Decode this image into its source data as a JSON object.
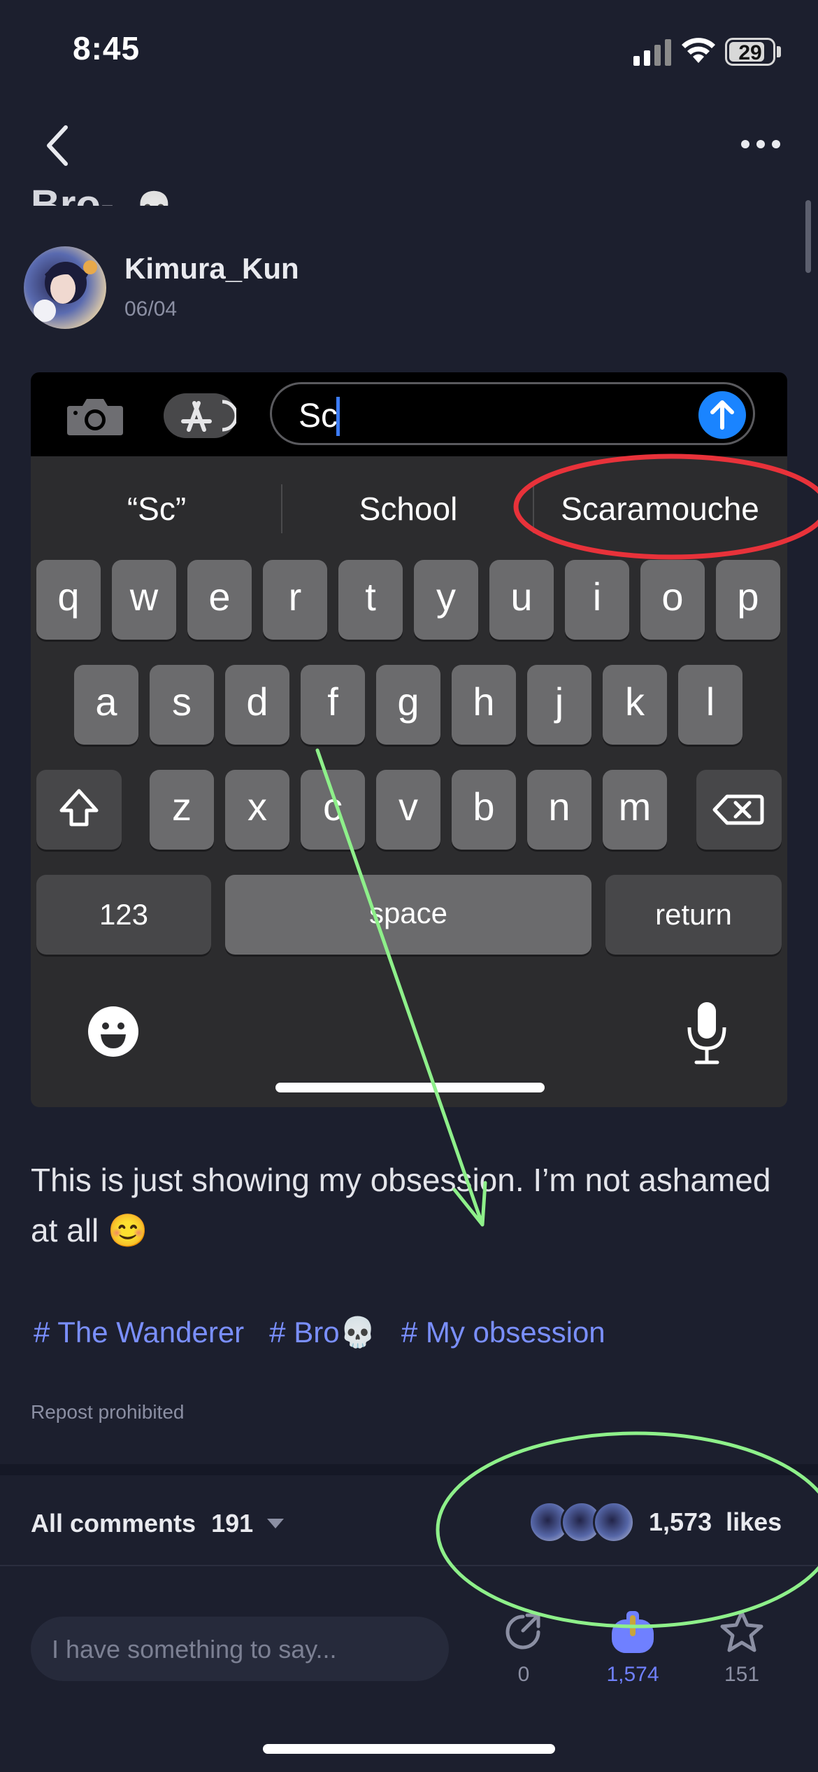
{
  "status_bar": {
    "time": "8:45",
    "battery": "29"
  },
  "post": {
    "title_fragment": "Bro-",
    "author": "Kimura_Kun",
    "date": "06/04",
    "body": "This is just showing my obsession. I’m not ashamed at all 😊",
    "tags": [
      "# The Wanderer",
      "# Bro💀",
      "# My obsession"
    ],
    "repost_notice": "Repost prohibited"
  },
  "embedded_screenshot": {
    "message_input_value": "Sc",
    "suggestions": [
      "“Sc”",
      "School",
      "Scaramouche"
    ],
    "keyboard": {
      "row1": [
        "q",
        "w",
        "e",
        "r",
        "t",
        "y",
        "u",
        "i",
        "o",
        "p"
      ],
      "row2": [
        "a",
        "s",
        "d",
        "f",
        "g",
        "h",
        "j",
        "k",
        "l"
      ],
      "row3": [
        "z",
        "x",
        "c",
        "v",
        "b",
        "n",
        "m"
      ],
      "numbers_key": "123",
      "space_key": "space",
      "return_key": "return"
    },
    "annotation_colors": {
      "ellipse": "#e8323a",
      "arrow": "#8ef08a"
    }
  },
  "comments_bar": {
    "label": "All comments",
    "count": "191",
    "likes_count": "1,573",
    "likes_word": "likes"
  },
  "bottom_bar": {
    "input_placeholder": "I have something to say...",
    "share_count": "0",
    "like_count": "1,574",
    "favorite_count": "151"
  },
  "colors": {
    "background": "#1c1f2e",
    "accent": "#7a8fff",
    "like_active": "#6f80ff",
    "likes_ellipse": "#8ef08a"
  }
}
